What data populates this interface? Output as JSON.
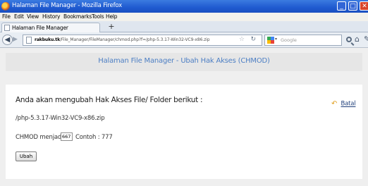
{
  "window": {
    "title": "Halaman File Manager - Mozilla Firefox"
  },
  "menu": [
    "File",
    "Edit",
    "View",
    "History",
    "Bookmarks",
    "Tools",
    "Help"
  ],
  "tab": {
    "label": "Halaman File Manager",
    "new_tab": "+"
  },
  "nav": {
    "url_host": "rakbuku.tk",
    "url_path": "/File_Manager/FileManager/chmod.php?f=/php-5.3.17-Win32-VC9-x86.zip",
    "search_placeholder": "Google"
  },
  "page": {
    "header_title": "Halaman File Manager - Ubah Hak Akses (CHMOD)",
    "heading": "Anda akan mengubah Hak Akses File/ Folder berikut :",
    "file_path": "/php-5.3.17-Win32-VC9-x86.zip",
    "chmod_label": "CHMOD menjadi :",
    "chmod_value": "667",
    "example": "Contoh : 777",
    "submit_label": "Ubah",
    "cancel_label": "Batal"
  },
  "icons": {
    "browser": "firefox-icon",
    "back": "back-arrow-icon",
    "forward": "forward-arrow-icon",
    "bookmark": "star-icon",
    "reload": "reload-icon",
    "search_engine": "google-icon",
    "search": "magnifier-icon",
    "home": "home-icon",
    "cancel": "undo-arrow-icon"
  },
  "colors": {
    "titlebar": "#1f5ad0",
    "header_text": "#4d7fc4",
    "link": "#1f3f7a"
  }
}
